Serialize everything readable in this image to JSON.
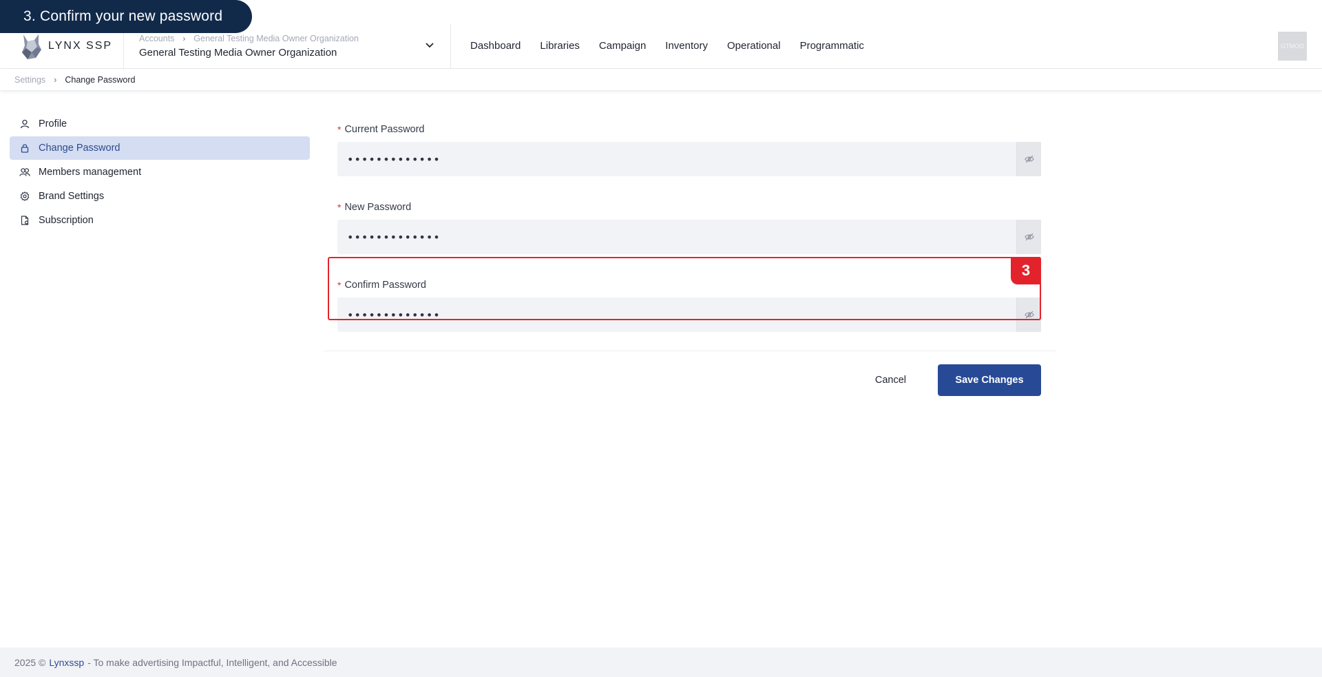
{
  "tutorial": {
    "step_label": "3. Confirm your new password",
    "badge_number": "3"
  },
  "header": {
    "logo_text": "LYNX SSP",
    "org_crumbs": [
      "Accounts",
      "General Testing Media Owner Organization"
    ],
    "org_name": "General Testing Media Owner Organization",
    "nav": [
      "Dashboard",
      "Libraries",
      "Campaign",
      "Inventory",
      "Operational",
      "Programmatic"
    ],
    "avatar_text": "GTMOO"
  },
  "breadcrumb": {
    "parent": "Settings",
    "current": "Change Password"
  },
  "sidebar": {
    "items": [
      {
        "label": "Profile",
        "icon": "user-icon",
        "active": false
      },
      {
        "label": "Change Password",
        "icon": "lock-icon",
        "active": true
      },
      {
        "label": "Members management",
        "icon": "users-icon",
        "active": false
      },
      {
        "label": "Brand Settings",
        "icon": "gear-icon",
        "active": false
      },
      {
        "label": "Subscription",
        "icon": "document-icon",
        "active": false
      }
    ]
  },
  "form": {
    "required_mark": "*",
    "current_password": {
      "label": "Current Password",
      "value": "•••••••••••••"
    },
    "new_password": {
      "label": "New Password",
      "value": "•••••••••••••"
    },
    "confirm_password": {
      "label": "Confirm Password",
      "value": "•••••••••••••"
    },
    "cancel_label": "Cancel",
    "save_label": "Save Changes"
  },
  "footer": {
    "year_text": "2025 ©",
    "brand": "Lynxssp",
    "tagline": "- To make advertising Impactful, Intelligent, and Accessible"
  },
  "colors": {
    "primary": "#284a96",
    "tutorial_bg": "#112a4a",
    "highlight": "#e3232b",
    "sidebar_active_bg": "#d4ddf1",
    "input_bg": "#f2f3f6"
  }
}
